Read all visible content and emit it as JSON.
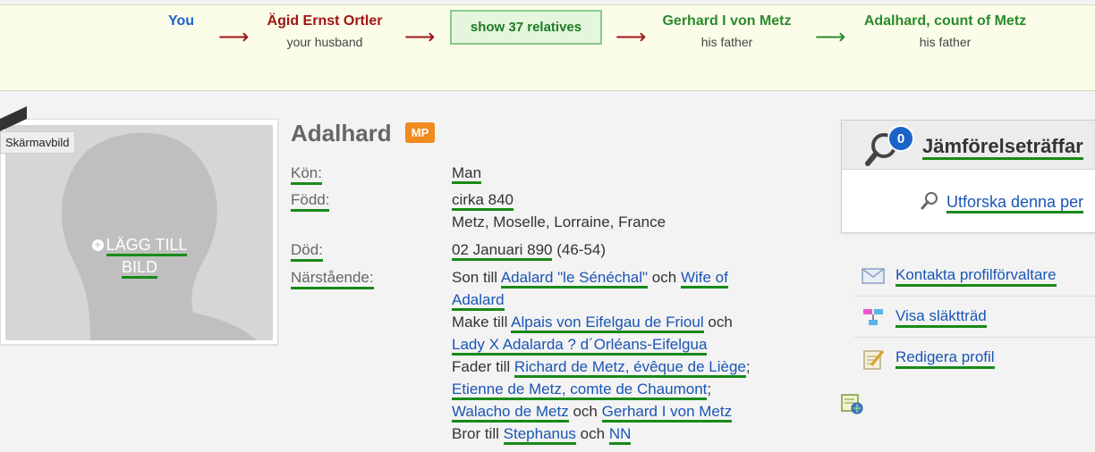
{
  "relationship_bar": {
    "you": "You",
    "person1": {
      "name": "Ägid Ernst Ortler",
      "relation": "your husband"
    },
    "show_button": "show 37 relatives",
    "person2": {
      "name": "Gerhard I von Metz",
      "relation": "his father"
    },
    "person3": {
      "name": "Adalhard, count of Metz",
      "relation": "his father"
    },
    "arrow": "⟶"
  },
  "photo": {
    "tooltip": "Skärmavbild",
    "add_line1": "LÄGG TILL",
    "add_line2": "BILD"
  },
  "profile": {
    "name": "Adalhard",
    "badge": "MP",
    "gender_label": "Kön:",
    "gender": "Man",
    "born_label": "Född:",
    "born_date": "cirka 840",
    "born_place": "Metz, Moselle, Lorraine, France",
    "died_label": "Död:",
    "died_date": "02 Januari 890",
    "died_age": "(46-54)",
    "relatives_label": "Närstående:",
    "relatives": {
      "son_of": "Son till",
      "father": "Adalard \"le Sénéchal\"",
      "och": "och",
      "mother_part1": "Wife of",
      "mother_part2": "Adalard",
      "spouse_of": "Make till",
      "spouse1": "Alpais von Eifelgau de Frioul",
      "spouse2": "Lady X Adalarda ? d´Orléans-Eifelgua",
      "father_of": "Fader till",
      "child1": "Richard de Metz, évêque de Liège",
      "child2": "Etienne de Metz, comte de Chaumont",
      "child3": "Walacho de Metz",
      "child4": "Gerhard I von Metz",
      "semicolon": ";",
      "brother_of": "Bror till",
      "sibling1": "Stephanus",
      "sibling2": "NN"
    }
  },
  "sidebar": {
    "matches_title": "Jämförelseträffar",
    "matches_count": "0",
    "explore": "Utforska denna per",
    "contact": "Kontakta profilförvaltare",
    "tree": "Visa släktträd",
    "edit": "Redigera profil"
  },
  "colors": {
    "link": "#1a55b5",
    "underline": "#188a18",
    "person_red": "#a01414",
    "person_green": "#2a8a2a",
    "badge_orange": "#f08a1c",
    "badge_blue": "#1a64c8"
  }
}
